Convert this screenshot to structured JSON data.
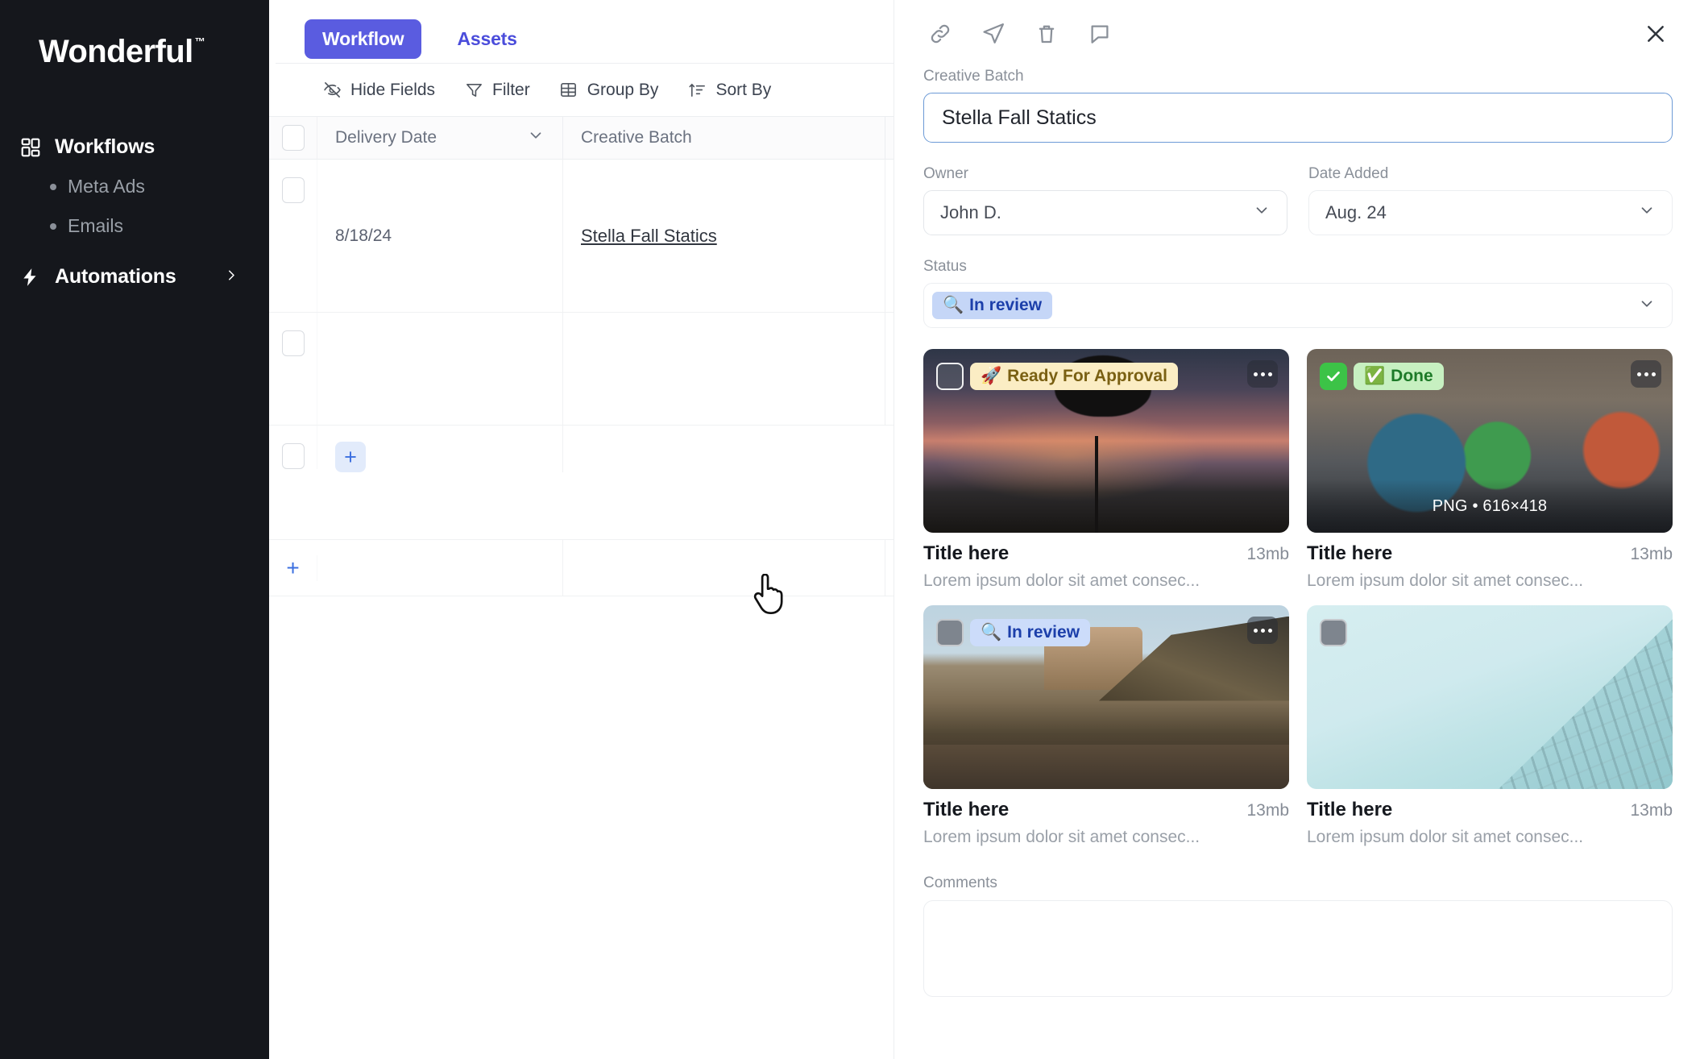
{
  "sidebar": {
    "brand": {
      "name": "Wonderful",
      "tm": "™"
    },
    "items": [
      {
        "label": "Workflows",
        "icon": "grid-icon",
        "type": "nav"
      },
      {
        "label": "Meta Ads",
        "icon": "bullet-dot",
        "type": "sub"
      },
      {
        "label": "Emails",
        "icon": "bullet-dot",
        "type": "sub"
      },
      {
        "label": "Automations",
        "icon": "lightning-icon",
        "type": "nav",
        "chevron": "chevron-right-icon"
      }
    ]
  },
  "center": {
    "tabs": [
      {
        "label": "Workflow",
        "active": true
      },
      {
        "label": "Assets",
        "active": false
      }
    ],
    "toolbar": [
      {
        "label": "Hide Fields",
        "icon": "eye-off-icon"
      },
      {
        "label": "Filter",
        "icon": "funnel-icon"
      },
      {
        "label": "Group By",
        "icon": "table-icon"
      },
      {
        "label": "Sort By",
        "icon": "sort-asc-icon"
      }
    ],
    "table": {
      "columns": [
        "Delivery Date",
        "Creative Batch"
      ],
      "rows": [
        {
          "delivery_date": "8/18/24",
          "creative_batch": "Stella Fall Statics"
        },
        {
          "delivery_date": "",
          "creative_batch": ""
        },
        {
          "delivery_date": "",
          "creative_batch": ""
        }
      ],
      "add_row_label": "+",
      "add_cell_label": "+"
    }
  },
  "detail": {
    "header_icons": [
      "link-icon",
      "send-icon",
      "trash-icon",
      "comment-icon"
    ],
    "close_icon": "close-icon",
    "fields": {
      "creative_batch": {
        "label": "Creative Batch",
        "value": "Stella Fall Statics"
      },
      "owner": {
        "label": "Owner",
        "value": "John D."
      },
      "date_added": {
        "label": "Date Added",
        "value": "Aug. 24"
      },
      "status": {
        "label": "Status",
        "value": "In review",
        "emoji": "🔍"
      }
    },
    "assets": [
      {
        "badge": "Ready For Approval",
        "badge_emoji": "🚀",
        "badge_kind": "approval",
        "title": "Title here",
        "size": "13mb",
        "desc": "Lorem ipsum dolor sit amet consec...",
        "meta": "",
        "selected": false,
        "art": "art-sunset"
      },
      {
        "badge": "Done",
        "badge_emoji": "✅",
        "badge_kind": "done",
        "title": "Title here",
        "size": "13mb",
        "desc": "Lorem ipsum dolor sit amet consec...",
        "meta": "PNG  •  616×418",
        "selected": true,
        "art": "art-selfie"
      },
      {
        "badge": "In review",
        "badge_emoji": "🔍",
        "badge_kind": "review",
        "title": "Title here",
        "size": "13mb",
        "desc": "Lorem ipsum dolor sit amet consec...",
        "meta": "",
        "selected": false,
        "art": "art-canyon"
      },
      {
        "badge": "",
        "badge_emoji": "",
        "badge_kind": "none",
        "title": "Title here",
        "size": "13mb",
        "desc": "Lorem ipsum dolor sit amet consec...",
        "meta": "",
        "selected": false,
        "art": "art-building"
      }
    ],
    "comments": {
      "label": "Comments",
      "value": ""
    }
  },
  "colors": {
    "accent": "#5a5ce0",
    "accent_text": "#4b4ddb",
    "sidebar_bg": "#15171c",
    "focus_border": "#6c9ad6",
    "status_pill_bg": "#c5d6f7",
    "status_pill_text": "#1c3faa",
    "done_green": "#3cc347",
    "approval_yellow": "#fbedc4"
  }
}
